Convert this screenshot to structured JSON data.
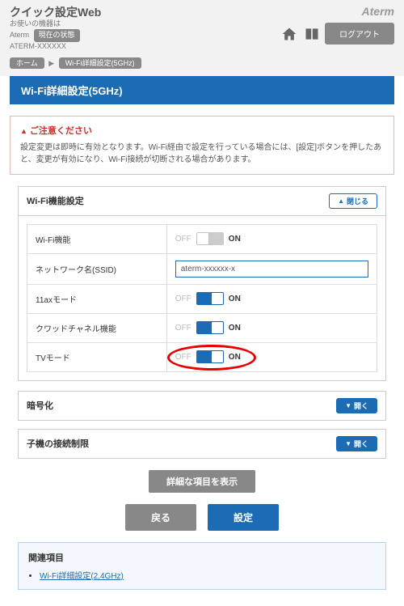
{
  "header": {
    "title": "クイック設定Web",
    "sub1": "お使いの機器は",
    "sub2_prefix": "Aterm",
    "sub3": "ATERM-XXXXXX",
    "status_btn": "現在の状態",
    "brand": "Aterm",
    "logout": "ログアウト"
  },
  "breadcrumb": {
    "home": "ホーム",
    "current": "Wi-Fi詳細設定(5GHz)"
  },
  "page_title": "Wi-Fi詳細設定(5GHz)",
  "notice": {
    "title": "ご注意ください",
    "body": "設定変更は即時に有効となります。Wi-Fi経由で設定を行っている場合には、[設定]ボタンを押したあと、変更が有効になり、Wi-Fi接続が切断される場合があります。"
  },
  "section1": {
    "title": "Wi-Fi機能設定",
    "close_btn": "閉じる",
    "off": "OFF",
    "on": "ON",
    "rows": {
      "wifi": "Wi-Fi機能",
      "ssid": "ネットワーク名(SSID)",
      "ssid_value": "aterm-xxxxxx-x",
      "ax": "11axモード",
      "quad": "クワッドチャネル機能",
      "tv": "TVモード"
    }
  },
  "section2": {
    "title": "暗号化",
    "open": "開く"
  },
  "section3": {
    "title": "子機の接続制限",
    "open": "開く"
  },
  "buttons": {
    "detail": "詳細な項目を表示",
    "back": "戻る",
    "set": "設定"
  },
  "related": {
    "title": "関連項目",
    "link": "Wi-Fi詳細設定(2.4GHz)"
  }
}
